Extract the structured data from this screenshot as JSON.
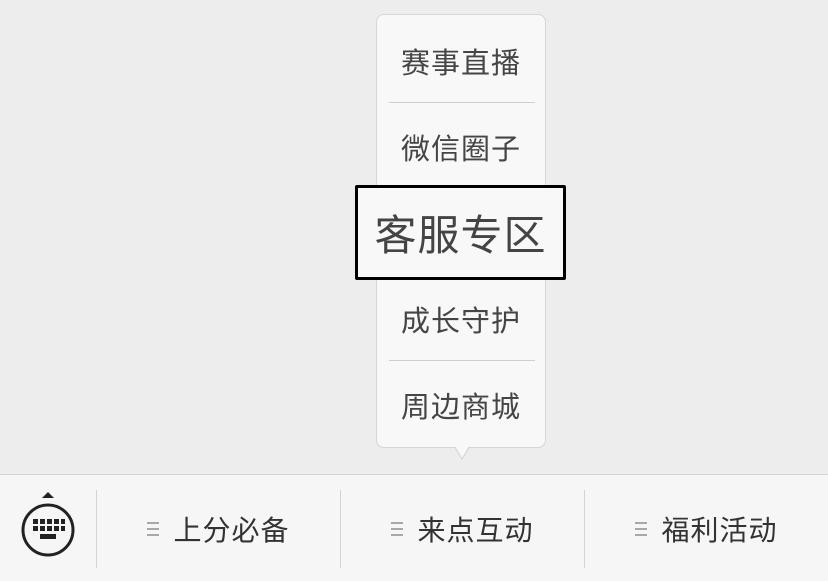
{
  "popup_menu": {
    "items": [
      {
        "label": "赛事直播"
      },
      {
        "label": "微信圈子"
      },
      {
        "label": "客服专区"
      },
      {
        "label": "成长守护"
      },
      {
        "label": "周边商城"
      }
    ],
    "highlighted_index": 2
  },
  "bottom_bar": {
    "keyboard_icon": "keyboard-icon",
    "tabs": [
      {
        "label": "上分必备",
        "icon": "menu-lines-icon"
      },
      {
        "label": "来点互动",
        "icon": "menu-lines-icon"
      },
      {
        "label": "福利活动",
        "icon": "menu-lines-icon"
      }
    ]
  },
  "colors": {
    "background": "#ededed",
    "popup_bg": "#f8f8f8",
    "text": "#333333",
    "highlight_border": "#000000",
    "divider": "#cfcfcf"
  }
}
